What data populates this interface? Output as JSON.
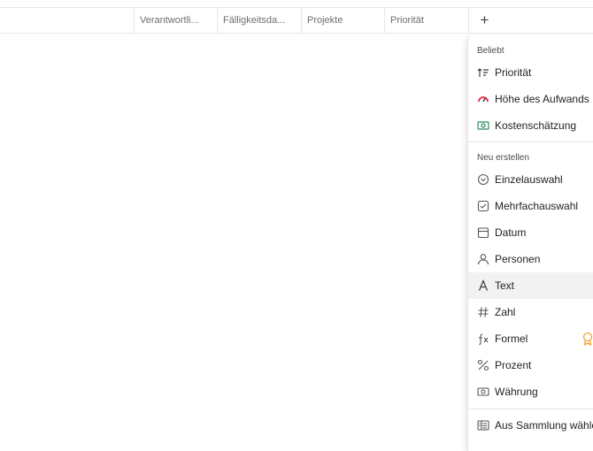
{
  "columns": [
    {
      "label": "Verantwortli..."
    },
    {
      "label": "Fälligkeitsda..."
    },
    {
      "label": "Projekte"
    },
    {
      "label": "Priorität"
    }
  ],
  "add_column": {
    "label": "+"
  },
  "menu": {
    "popular_title": "Beliebt",
    "popular_items": [
      {
        "label": "Priorität",
        "icon": "priority-icon"
      },
      {
        "label": "Höhe des Aufwands",
        "icon": "gauge-icon"
      },
      {
        "label": "Kostenschätzung",
        "icon": "money-icon"
      }
    ],
    "create_title": "Neu erstellen",
    "create_items": [
      {
        "label": "Einzelauswahl",
        "icon": "single-select-icon"
      },
      {
        "label": "Mehrfachauswahl",
        "icon": "multi-select-icon"
      },
      {
        "label": "Datum",
        "icon": "calendar-icon"
      },
      {
        "label": "Personen",
        "icon": "person-icon"
      },
      {
        "label": "Text",
        "icon": "text-icon"
      },
      {
        "label": "Zahl",
        "icon": "hash-icon"
      },
      {
        "label": "Formel",
        "icon": "formula-icon"
      },
      {
        "label": "Prozent",
        "icon": "percent-icon"
      },
      {
        "label": "Währung",
        "icon": "currency-icon"
      }
    ],
    "library_item": {
      "label": "Aus Sammlung wählen",
      "icon": "library-icon"
    },
    "hovered_item": "Text",
    "upgrade_badge_color": "#f0a63b"
  }
}
